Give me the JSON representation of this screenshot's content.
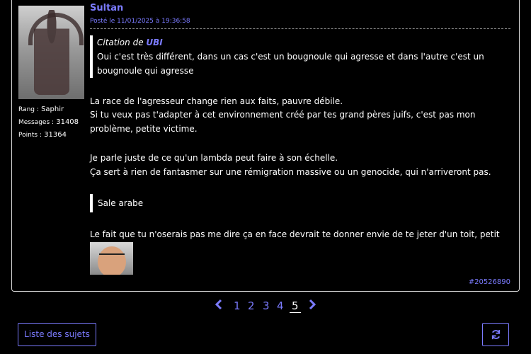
{
  "post": {
    "author": "Sultan",
    "date": "Posté le 11/01/2025 à 19:36:58",
    "stats": {
      "rank_label": "Rang :",
      "rank": "Saphir",
      "messages_label": "Messages :",
      "messages": "31408",
      "points_label": "Points :",
      "points": "31364"
    },
    "quote": {
      "cite_prefix": "Citation de",
      "cite_author": "UBI",
      "text": "Oui c'est très différent, dans un cas c'est un bougnoule qui agresse et dans l'autre c'est un bougnoule qui agresse"
    },
    "paragraphs": [
      "La race de l'agresseur change rien aux faits, pauvre débile.",
      "Si tu veux pas t'adapter à cet environnement créé par tes grand pères juifs, c'est pas mon problème, petite victime.",
      "Je parle juste de ce qu'un lambda peut faire à son échelle.",
      "Ça sert à rien de fantasmer sur une rémigration massive ou un genocide, qui n'arriveront pas.",
      "Le fait que tu n'oserais pas me dire ça en face devrait te donner envie de te jeter d'un toit, petit lâche."
    ],
    "quote2": "Sale arabe",
    "message_id": "#20526890"
  },
  "pagination": {
    "pages": [
      "1",
      "2",
      "3",
      "4",
      "5"
    ],
    "current": "5"
  },
  "buttons": {
    "topics": "Liste des sujets"
  },
  "colors": {
    "accent": "#7b7bff",
    "background": "#000000",
    "text": "#ffffff"
  },
  "icons": {
    "prev": "chevron-left-icon",
    "next": "chevron-right-icon",
    "refresh": "refresh-icon"
  }
}
